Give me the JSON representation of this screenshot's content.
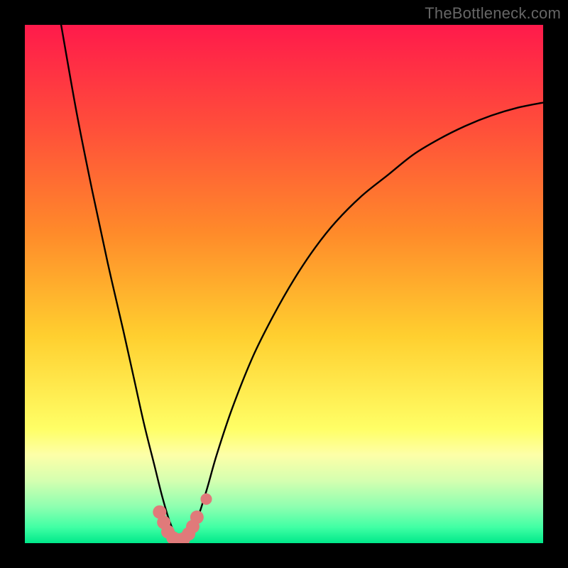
{
  "watermark": "TheBottleneck.com",
  "chart_data": {
    "type": "line",
    "title": "",
    "xlabel": "",
    "ylabel": "",
    "xlim": [
      0,
      100
    ],
    "ylim": [
      0,
      100
    ],
    "grid": false,
    "legend": false,
    "background_gradient": {
      "stops": [
        {
          "offset": 0.0,
          "color": "#ff1a4b"
        },
        {
          "offset": 0.2,
          "color": "#ff4f3a"
        },
        {
          "offset": 0.4,
          "color": "#ff8a2a"
        },
        {
          "offset": 0.6,
          "color": "#ffcf2f"
        },
        {
          "offset": 0.78,
          "color": "#ffff66"
        },
        {
          "offset": 0.83,
          "color": "#fdffa8"
        },
        {
          "offset": 0.88,
          "color": "#d4ffb0"
        },
        {
          "offset": 0.93,
          "color": "#8dffb0"
        },
        {
          "offset": 0.97,
          "color": "#3fffa4"
        },
        {
          "offset": 1.0,
          "color": "#00e88a"
        }
      ]
    },
    "series": [
      {
        "name": "bottleneck-curve",
        "x": [
          7,
          10,
          13,
          16,
          19,
          21,
          23,
          25,
          26.5,
          28,
          29.5,
          31,
          33,
          35,
          37,
          40,
          44,
          48,
          52,
          56,
          60,
          65,
          70,
          75,
          80,
          85,
          90,
          95,
          100
        ],
        "y": [
          100,
          83,
          68,
          54,
          41,
          32,
          23,
          15,
          9,
          4,
          1,
          1,
          4,
          10,
          17,
          26,
          36,
          44,
          51,
          57,
          62,
          67,
          71,
          75,
          78,
          80.5,
          82.5,
          84,
          85
        ]
      }
    ],
    "markers": {
      "name": "bottom-cluster",
      "color": "#e07a7a",
      "points": [
        {
          "x": 26.0,
          "y": 6.0,
          "r": 1.3
        },
        {
          "x": 26.8,
          "y": 4.0,
          "r": 1.3
        },
        {
          "x": 27.6,
          "y": 2.2,
          "r": 1.3
        },
        {
          "x": 28.6,
          "y": 1.0,
          "r": 1.3
        },
        {
          "x": 29.6,
          "y": 0.6,
          "r": 1.3
        },
        {
          "x": 30.6,
          "y": 0.8,
          "r": 1.3
        },
        {
          "x": 31.6,
          "y": 1.8,
          "r": 1.3
        },
        {
          "x": 32.4,
          "y": 3.2,
          "r": 1.3
        },
        {
          "x": 33.2,
          "y": 5.0,
          "r": 1.3
        },
        {
          "x": 35.0,
          "y": 8.5,
          "r": 1.1
        }
      ]
    }
  }
}
